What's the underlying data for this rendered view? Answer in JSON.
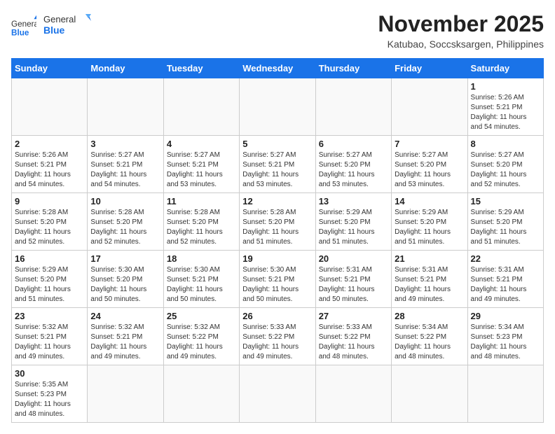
{
  "header": {
    "logo_general": "General",
    "logo_blue": "Blue",
    "month_title": "November 2025",
    "location": "Katubao, Soccsksargen, Philippines"
  },
  "weekdays": [
    "Sunday",
    "Monday",
    "Tuesday",
    "Wednesday",
    "Thursday",
    "Friday",
    "Saturday"
  ],
  "weeks": [
    [
      {
        "day": "",
        "info": ""
      },
      {
        "day": "",
        "info": ""
      },
      {
        "day": "",
        "info": ""
      },
      {
        "day": "",
        "info": ""
      },
      {
        "day": "",
        "info": ""
      },
      {
        "day": "",
        "info": ""
      },
      {
        "day": "1",
        "info": "Sunrise: 5:26 AM\nSunset: 5:21 PM\nDaylight: 11 hours\nand 54 minutes."
      }
    ],
    [
      {
        "day": "2",
        "info": "Sunrise: 5:26 AM\nSunset: 5:21 PM\nDaylight: 11 hours\nand 54 minutes."
      },
      {
        "day": "3",
        "info": "Sunrise: 5:27 AM\nSunset: 5:21 PM\nDaylight: 11 hours\nand 54 minutes."
      },
      {
        "day": "4",
        "info": "Sunrise: 5:27 AM\nSunset: 5:21 PM\nDaylight: 11 hours\nand 53 minutes."
      },
      {
        "day": "5",
        "info": "Sunrise: 5:27 AM\nSunset: 5:21 PM\nDaylight: 11 hours\nand 53 minutes."
      },
      {
        "day": "6",
        "info": "Sunrise: 5:27 AM\nSunset: 5:20 PM\nDaylight: 11 hours\nand 53 minutes."
      },
      {
        "day": "7",
        "info": "Sunrise: 5:27 AM\nSunset: 5:20 PM\nDaylight: 11 hours\nand 53 minutes."
      },
      {
        "day": "8",
        "info": "Sunrise: 5:27 AM\nSunset: 5:20 PM\nDaylight: 11 hours\nand 52 minutes."
      }
    ],
    [
      {
        "day": "9",
        "info": "Sunrise: 5:28 AM\nSunset: 5:20 PM\nDaylight: 11 hours\nand 52 minutes."
      },
      {
        "day": "10",
        "info": "Sunrise: 5:28 AM\nSunset: 5:20 PM\nDaylight: 11 hours\nand 52 minutes."
      },
      {
        "day": "11",
        "info": "Sunrise: 5:28 AM\nSunset: 5:20 PM\nDaylight: 11 hours\nand 52 minutes."
      },
      {
        "day": "12",
        "info": "Sunrise: 5:28 AM\nSunset: 5:20 PM\nDaylight: 11 hours\nand 51 minutes."
      },
      {
        "day": "13",
        "info": "Sunrise: 5:29 AM\nSunset: 5:20 PM\nDaylight: 11 hours\nand 51 minutes."
      },
      {
        "day": "14",
        "info": "Sunrise: 5:29 AM\nSunset: 5:20 PM\nDaylight: 11 hours\nand 51 minutes."
      },
      {
        "day": "15",
        "info": "Sunrise: 5:29 AM\nSunset: 5:20 PM\nDaylight: 11 hours\nand 51 minutes."
      }
    ],
    [
      {
        "day": "16",
        "info": "Sunrise: 5:29 AM\nSunset: 5:20 PM\nDaylight: 11 hours\nand 51 minutes."
      },
      {
        "day": "17",
        "info": "Sunrise: 5:30 AM\nSunset: 5:20 PM\nDaylight: 11 hours\nand 50 minutes."
      },
      {
        "day": "18",
        "info": "Sunrise: 5:30 AM\nSunset: 5:21 PM\nDaylight: 11 hours\nand 50 minutes."
      },
      {
        "day": "19",
        "info": "Sunrise: 5:30 AM\nSunset: 5:21 PM\nDaylight: 11 hours\nand 50 minutes."
      },
      {
        "day": "20",
        "info": "Sunrise: 5:31 AM\nSunset: 5:21 PM\nDaylight: 11 hours\nand 50 minutes."
      },
      {
        "day": "21",
        "info": "Sunrise: 5:31 AM\nSunset: 5:21 PM\nDaylight: 11 hours\nand 49 minutes."
      },
      {
        "day": "22",
        "info": "Sunrise: 5:31 AM\nSunset: 5:21 PM\nDaylight: 11 hours\nand 49 minutes."
      }
    ],
    [
      {
        "day": "23",
        "info": "Sunrise: 5:32 AM\nSunset: 5:21 PM\nDaylight: 11 hours\nand 49 minutes."
      },
      {
        "day": "24",
        "info": "Sunrise: 5:32 AM\nSunset: 5:21 PM\nDaylight: 11 hours\nand 49 minutes."
      },
      {
        "day": "25",
        "info": "Sunrise: 5:32 AM\nSunset: 5:22 PM\nDaylight: 11 hours\nand 49 minutes."
      },
      {
        "day": "26",
        "info": "Sunrise: 5:33 AM\nSunset: 5:22 PM\nDaylight: 11 hours\nand 49 minutes."
      },
      {
        "day": "27",
        "info": "Sunrise: 5:33 AM\nSunset: 5:22 PM\nDaylight: 11 hours\nand 48 minutes."
      },
      {
        "day": "28",
        "info": "Sunrise: 5:34 AM\nSunset: 5:22 PM\nDaylight: 11 hours\nand 48 minutes."
      },
      {
        "day": "29",
        "info": "Sunrise: 5:34 AM\nSunset: 5:23 PM\nDaylight: 11 hours\nand 48 minutes."
      }
    ],
    [
      {
        "day": "30",
        "info": "Sunrise: 5:35 AM\nSunset: 5:23 PM\nDaylight: 11 hours\nand 48 minutes."
      },
      {
        "day": "",
        "info": ""
      },
      {
        "day": "",
        "info": ""
      },
      {
        "day": "",
        "info": ""
      },
      {
        "day": "",
        "info": ""
      },
      {
        "day": "",
        "info": ""
      },
      {
        "day": "",
        "info": ""
      }
    ]
  ]
}
